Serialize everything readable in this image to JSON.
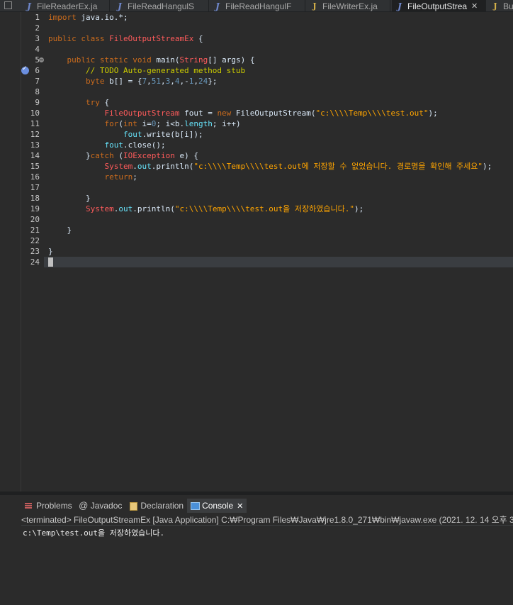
{
  "tabs": [
    {
      "label": "FileReaderEx.ja",
      "icon": "java-file-icon",
      "glyph": "J",
      "active": false
    },
    {
      "label": "FileReadHangulS",
      "icon": "java-file-icon",
      "glyph": "J",
      "active": false
    },
    {
      "label": "FileReadHangulF",
      "icon": "java-file-icon",
      "glyph": "J",
      "active": false
    },
    {
      "label": "FileWriterEx.ja",
      "icon": "java-warning-file-icon",
      "glyph": "J",
      "active": false
    },
    {
      "label": "FileOutputStrea",
      "icon": "java-file-icon",
      "glyph": "J",
      "active": true,
      "close": "✕"
    },
    {
      "label": "Bu",
      "icon": "java-warning-file-icon",
      "glyph": "J",
      "active": false
    }
  ],
  "editor": {
    "line_numbers": [
      "1",
      "2",
      "3",
      "4",
      "5",
      "6",
      "7",
      "8",
      "9",
      "10",
      "11",
      "12",
      "13",
      "14",
      "15",
      "16",
      "17",
      "18",
      "19",
      "20",
      "21",
      "22",
      "23",
      "24"
    ],
    "fold_line": 5,
    "bookmark_line": 6,
    "current_line": 24
  },
  "console": {
    "tabs": [
      {
        "label": "Problems",
        "icon": "problems-icon"
      },
      {
        "label": "Javadoc",
        "icon": "javadoc-icon"
      },
      {
        "label": "Declaration",
        "icon": "declaration-icon"
      },
      {
        "label": "Console",
        "icon": "console-icon",
        "active": true,
        "close": "✕"
      }
    ],
    "status": "<terminated> FileOutputStreamEx [Java Application] C:₩Program Files₩Java₩jre1.8.0_271₩bin₩javaw.exe  (2021. 12. 14 오후 3",
    "output": "c:\\Temp\\test.out을 저장하였습니다."
  }
}
